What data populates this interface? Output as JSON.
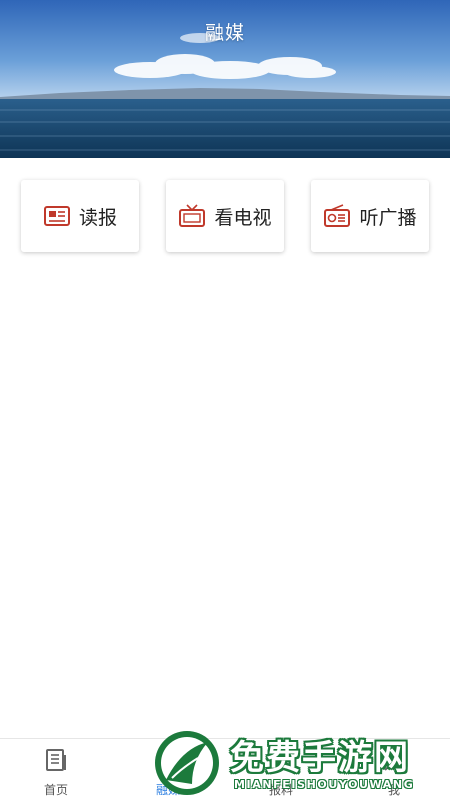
{
  "header": {
    "title": "融媒"
  },
  "cards": [
    {
      "label": "读报",
      "icon": "newspaper-icon"
    },
    {
      "label": "看电视",
      "icon": "tv-icon"
    },
    {
      "label": "听广播",
      "icon": "radio-icon"
    }
  ],
  "tabs": [
    {
      "label": "首页",
      "icon": "document-icon",
      "active": false
    },
    {
      "label": "融媒",
      "icon": "media-icon",
      "active": true
    },
    {
      "label": "报料",
      "icon": "camera-icon",
      "active": false
    },
    {
      "label": "我",
      "icon": "user-icon",
      "active": false
    }
  ],
  "watermark": {
    "text": "免费手游网",
    "sub": "MIANFEISHOUYOUWANG"
  },
  "colors": {
    "accent": "#2d7fe0",
    "icon_red": "#c0392b",
    "watermark_green": "#1c7a3c"
  }
}
